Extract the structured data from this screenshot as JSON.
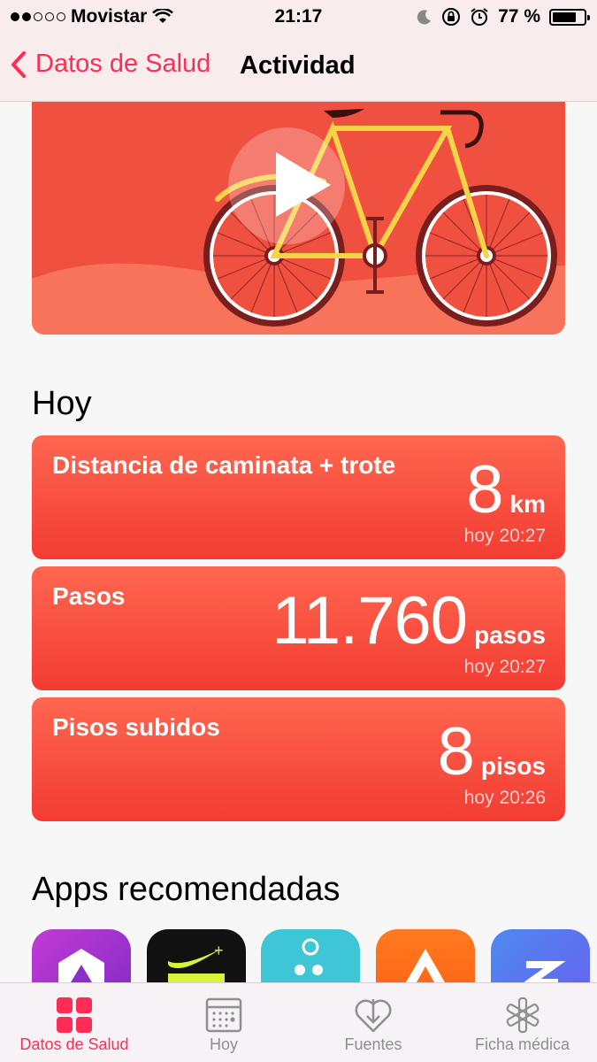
{
  "status_bar": {
    "carrier": "Movistar",
    "time": "21:17",
    "battery": "77 %",
    "battery_level": 0.77
  },
  "nav": {
    "back_label": "Datos de Salud",
    "title": "Actividad"
  },
  "sections": {
    "today_title": "Hoy",
    "apps_title": "Apps recomendadas"
  },
  "cards": [
    {
      "title": "Distancia de caminata + trote",
      "value": "8",
      "unit": "km",
      "time": "hoy 20:27"
    },
    {
      "title": "Pasos",
      "value": "11.760",
      "unit": "pasos",
      "time": "hoy 20:27"
    },
    {
      "title": "Pisos subidos",
      "value": "8",
      "unit": "pisos",
      "time": "hoy 20:26"
    }
  ],
  "apps": [
    {
      "name": "health-app",
      "color": "#9b2fc9"
    },
    {
      "name": "nike-run-club",
      "color": "#111111",
      "label": "+"
    },
    {
      "name": "runner-app",
      "color": "#3ec6d6"
    },
    {
      "name": "strava-like-app",
      "color": "#ff6a1a"
    },
    {
      "name": "zombies-run-app",
      "color": "#5a6cf0"
    }
  ],
  "tabs": [
    {
      "label": "Datos de Salud",
      "icon": "grid-icon",
      "active": true
    },
    {
      "label": "Hoy",
      "icon": "calendar-icon",
      "active": false
    },
    {
      "label": "Fuentes",
      "icon": "download-heart-icon",
      "active": false
    },
    {
      "label": "Ficha médica",
      "icon": "medical-asterisk-icon",
      "active": false
    }
  ],
  "colors": {
    "accent": "#ff2d55",
    "card": "#f23c32",
    "hero": "#f05040"
  }
}
